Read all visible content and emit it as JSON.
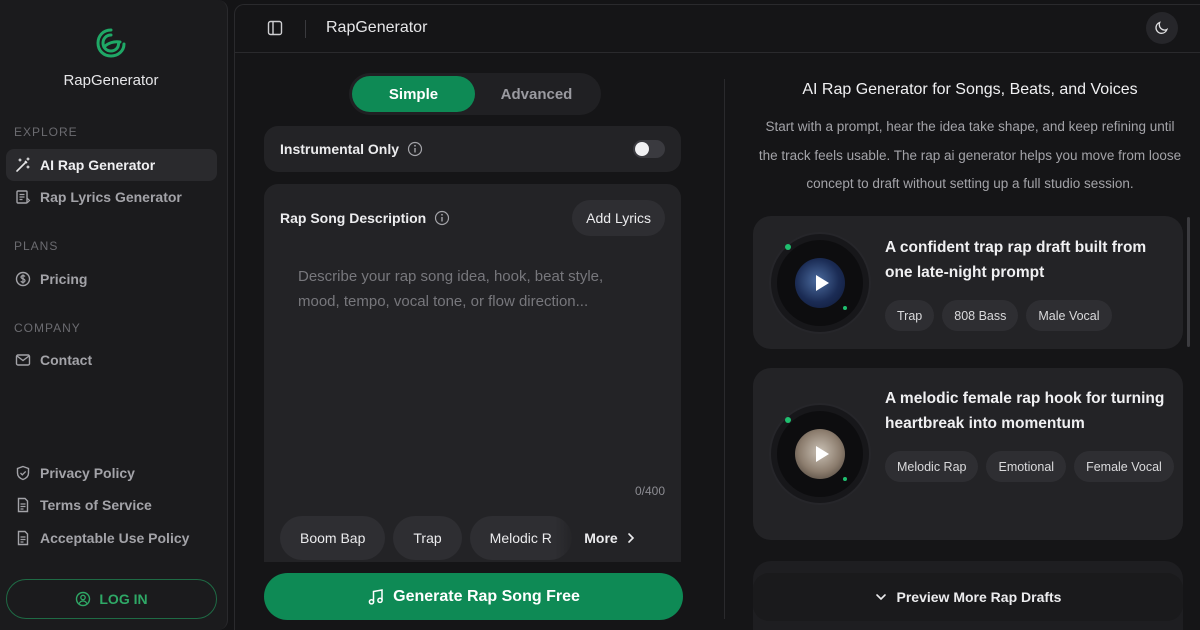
{
  "brand": {
    "name": "RapGenerator",
    "accent": "#0e8a55"
  },
  "sidebar": {
    "sections": [
      {
        "label": "EXPLORE"
      },
      {
        "label": "PLANS"
      },
      {
        "label": "COMPANY"
      }
    ],
    "items": [
      {
        "label": "AI Rap Generator",
        "icon": "magic-wand-icon",
        "active": true
      },
      {
        "label": "Rap Lyrics Generator",
        "icon": "lyrics-icon"
      },
      {
        "label": "Pricing",
        "icon": "dollar-circle-icon"
      },
      {
        "label": "Contact",
        "icon": "mail-icon"
      },
      {
        "label": "Privacy Policy",
        "icon": "shield-icon"
      },
      {
        "label": "Terms of Service",
        "icon": "document-icon"
      },
      {
        "label": "Acceptable Use Policy",
        "icon": "document-icon"
      }
    ],
    "login_label": "LOG IN"
  },
  "topbar": {
    "title": "RapGenerator"
  },
  "form": {
    "modes": [
      "Simple",
      "Advanced"
    ],
    "active_mode": "Simple",
    "instrumental_label": "Instrumental Only",
    "instrumental_on": false,
    "description_label": "Rap Song Description",
    "add_lyrics_label": "Add Lyrics",
    "placeholder": "Describe your rap song idea, hook, beat style, mood, tempo, vocal tone, or flow direction...",
    "counter": "0/400",
    "chips": [
      "Boom Bap",
      "Trap",
      "Melodic R"
    ],
    "more_label": "More",
    "generate_label": "Generate Rap Song Free"
  },
  "showcase": {
    "title": "AI Rap Generator for Songs, Beats, and Voices",
    "description": "Start with a prompt, hear the idea take shape, and keep refining until the track feels usable. The rap ai generator helps you move from loose concept to draft without setting up a full studio session.",
    "tracks": [
      {
        "title": "A confident trap rap draft built from one late-night prompt",
        "tags": [
          "Trap",
          "808 Bass",
          "Male Vocal"
        ]
      },
      {
        "title": "A melodic female rap hook for turning heartbreak into momentum",
        "tags": [
          "Melodic Rap",
          "Emotional",
          "Female Vocal"
        ]
      }
    ],
    "preview_more_label": "Preview More Rap Drafts"
  }
}
